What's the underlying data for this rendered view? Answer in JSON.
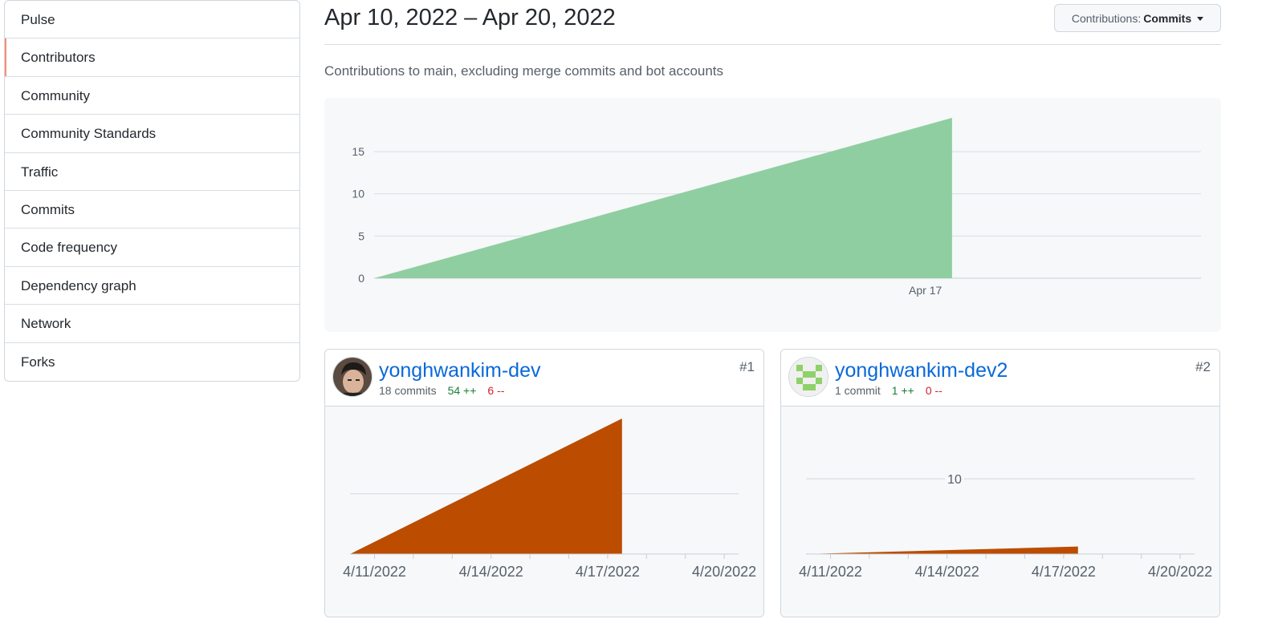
{
  "sidebar": {
    "items": [
      {
        "label": "Pulse",
        "active": false
      },
      {
        "label": "Contributors",
        "active": true
      },
      {
        "label": "Community",
        "active": false
      },
      {
        "label": "Community Standards",
        "active": false
      },
      {
        "label": "Traffic",
        "active": false
      },
      {
        "label": "Commits",
        "active": false
      },
      {
        "label": "Code frequency",
        "active": false
      },
      {
        "label": "Dependency graph",
        "active": false
      },
      {
        "label": "Network",
        "active": false
      },
      {
        "label": "Forks",
        "active": false
      }
    ]
  },
  "header": {
    "range": "Apr 10, 2022 – Apr 20, 2022",
    "contrib_prefix": "Contributions:",
    "contrib_value": "Commits",
    "subtitle": "Contributions to main, excluding merge commits and bot accounts"
  },
  "colors": {
    "accent": "#fd8c73",
    "overview_fill": "#8fcea0",
    "contributor_fill": "#bc4c00",
    "link": "#0969da",
    "additions": "#1a7f37",
    "deletions": "#cf222e"
  },
  "contributors": [
    {
      "name": "yonghwankim-dev",
      "commits": "18 commits",
      "additions": "54 ++",
      "deletions": "6 --",
      "rank": "#1",
      "avatar_icon": "photo-avatar"
    },
    {
      "name": "yonghwankim-dev2",
      "commits": "1 commit",
      "additions": "1 ++",
      "deletions": "0 --",
      "rank": "#2",
      "avatar_icon": "identicon-avatar"
    }
  ],
  "chart_data": [
    {
      "type": "area",
      "x": [
        0,
        6.5
      ],
      "y": [
        0,
        19
      ],
      "yticks": [
        0,
        5,
        10,
        15
      ],
      "xticks": [
        {
          "label": "Apr 17",
          "x": 6.2
        }
      ],
      "xlim": [
        0,
        9.3
      ],
      "ylim": [
        0,
        19
      ],
      "grid": true
    },
    {
      "type": "area",
      "x": [
        0,
        7
      ],
      "y": [
        0,
        18
      ],
      "xticks": [
        {
          "label": "4/11/2022",
          "x": 0.63
        },
        {
          "label": "4/14/2022",
          "x": 3.63
        },
        {
          "label": "4/17/2022",
          "x": 6.63
        },
        {
          "label": "4/20/2022",
          "x": 9.63
        }
      ],
      "gridlines": [
        8
      ],
      "gridline_labels": [
        ""
      ],
      "xlim": [
        0,
        10
      ],
      "ylim": [
        0,
        18
      ]
    },
    {
      "type": "area",
      "x": [
        0,
        7
      ],
      "y": [
        0,
        1
      ],
      "xticks": [
        {
          "label": "4/11/2022",
          "x": 0.63
        },
        {
          "label": "4/14/2022",
          "x": 3.63
        },
        {
          "label": "4/17/2022",
          "x": 6.63
        },
        {
          "label": "4/20/2022",
          "x": 9.63
        }
      ],
      "gridlines": [
        10
      ],
      "gridline_labels": [
        "10"
      ],
      "xlim": [
        0,
        10
      ],
      "ylim": [
        0,
        18
      ]
    }
  ]
}
